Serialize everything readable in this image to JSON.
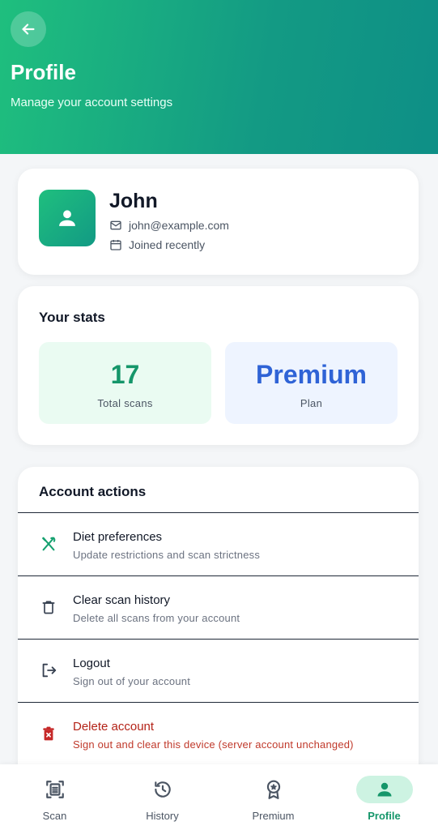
{
  "header": {
    "title": "Profile",
    "subtitle": "Manage your account settings"
  },
  "profile": {
    "name": "John",
    "email": "john@example.com",
    "joined": "Joined recently"
  },
  "stats": {
    "title": "Your stats",
    "total_scans_value": "17",
    "total_scans_label": "Total scans",
    "plan_value": "Premium",
    "plan_label": "Plan"
  },
  "actions": {
    "title": "Account actions",
    "items": [
      {
        "title": "Diet preferences",
        "subtitle": "Update restrictions and scan strictness",
        "icon": "fork-knife-icon"
      },
      {
        "title": "Clear scan history",
        "subtitle": "Delete all scans from your account",
        "icon": "trash-icon"
      },
      {
        "title": "Logout",
        "subtitle": "Sign out of your account",
        "icon": "logout-icon"
      },
      {
        "title": "Delete account",
        "subtitle": "Sign out and clear this device (server account unchanged)",
        "icon": "delete-account-icon"
      }
    ]
  },
  "nav": {
    "items": [
      {
        "label": "Scan",
        "icon": "scan-icon"
      },
      {
        "label": "History",
        "icon": "history-icon"
      },
      {
        "label": "Premium",
        "icon": "premium-badge-icon"
      },
      {
        "label": "Profile",
        "icon": "profile-icon"
      }
    ],
    "active": "Profile"
  },
  "colors": {
    "brand_green": "#1fbf7e",
    "brand_teal": "#0e8f86",
    "stat_green": "#15966a",
    "stat_blue": "#2f63d6",
    "danger": "#b42318"
  }
}
